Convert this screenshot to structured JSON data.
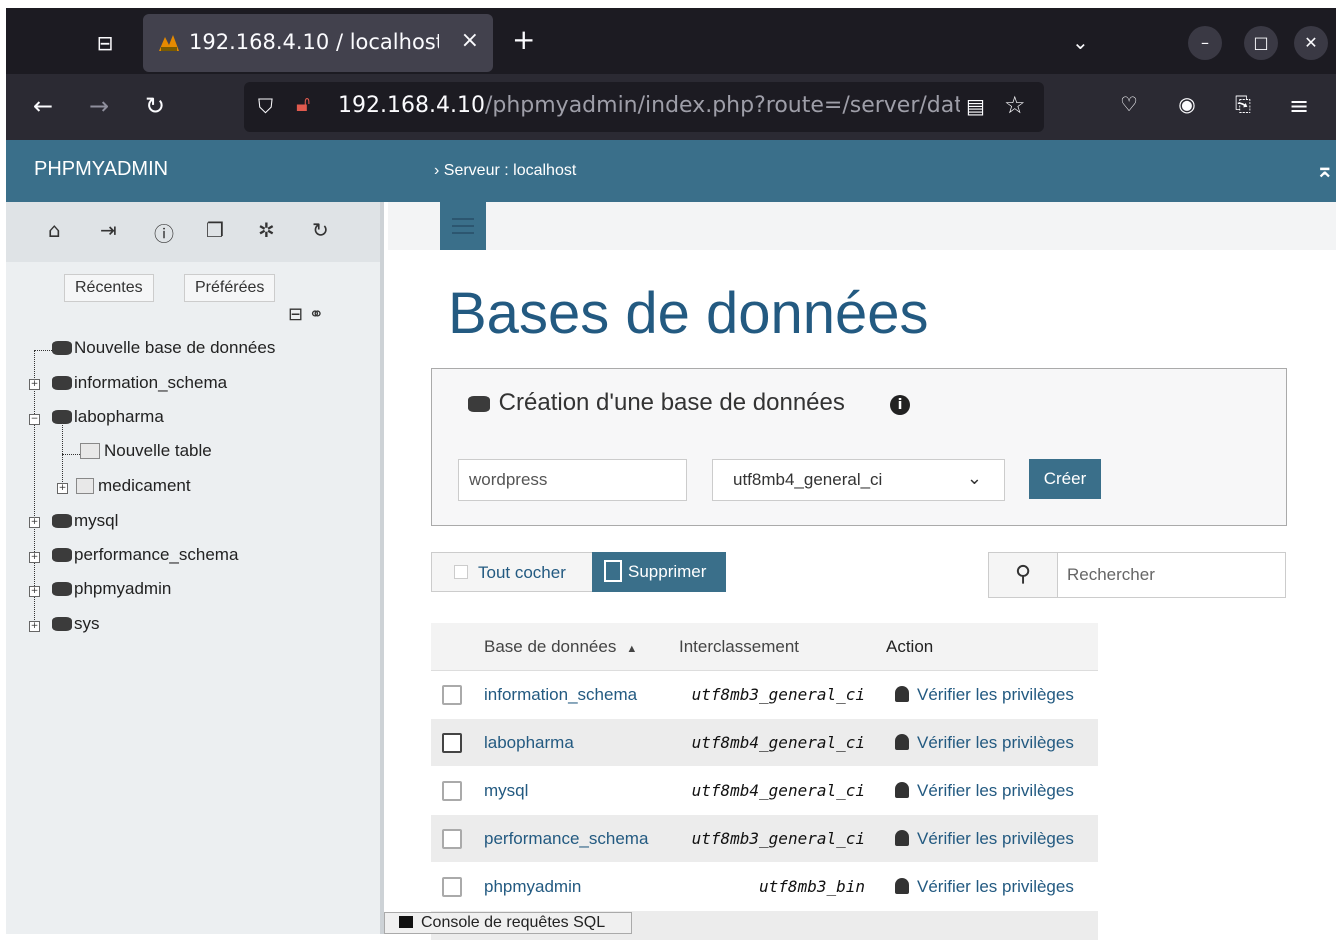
{
  "browser": {
    "tab_title": "192.168.4.10 / localhost",
    "url_host": "192.168.4.10",
    "url_rest": "/phpmyadmin/index.php?route=/server/dat",
    "new_tab": "+",
    "close_tab": "×"
  },
  "pma": {
    "brand": "PHPMYADMIN",
    "breadcrumb": "› Serveur : localhost",
    "sidebar": {
      "recent_label": "Récentes",
      "favorites_label": "Préférées",
      "tree": {
        "new_db": "Nouvelle base de données",
        "information_schema": "information_schema",
        "labopharma": "labopharma",
        "new_table": "Nouvelle table",
        "medicament": "medicament",
        "mysql": "mysql",
        "performance_schema": "performance_schema",
        "phpmyadmin": "phpmyadmin",
        "sys": "sys"
      }
    },
    "page_title": "Bases de données",
    "create": {
      "header": "Création d'une base de données",
      "db_name_value": "wordpress",
      "collation_value": "utf8mb4_general_ci",
      "create_button": "Créer"
    },
    "toolbar": {
      "check_all": "Tout cocher",
      "delete": "Supprimer",
      "search_placeholder": "Rechercher"
    },
    "table": {
      "headers": {
        "db": "Base de données",
        "collation": "Interclassement",
        "action": "Action"
      },
      "rows": [
        {
          "name": "information_schema",
          "collation": "utf8mb3_general_ci",
          "action": "Vérifier les privilèges"
        },
        {
          "name": "labopharma",
          "collation": "utf8mb4_general_ci",
          "action": "Vérifier les privilèges"
        },
        {
          "name": "mysql",
          "collation": "utf8mb4_general_ci",
          "action": "Vérifier les privilèges"
        },
        {
          "name": "performance_schema",
          "collation": "utf8mb3_general_ci",
          "action": "Vérifier les privilèges"
        },
        {
          "name": "phpmyadmin",
          "collation": "utf8mb3_bin",
          "action": "Vérifier les privilèges"
        }
      ]
    },
    "console_label": "Console de requêtes SQL"
  }
}
